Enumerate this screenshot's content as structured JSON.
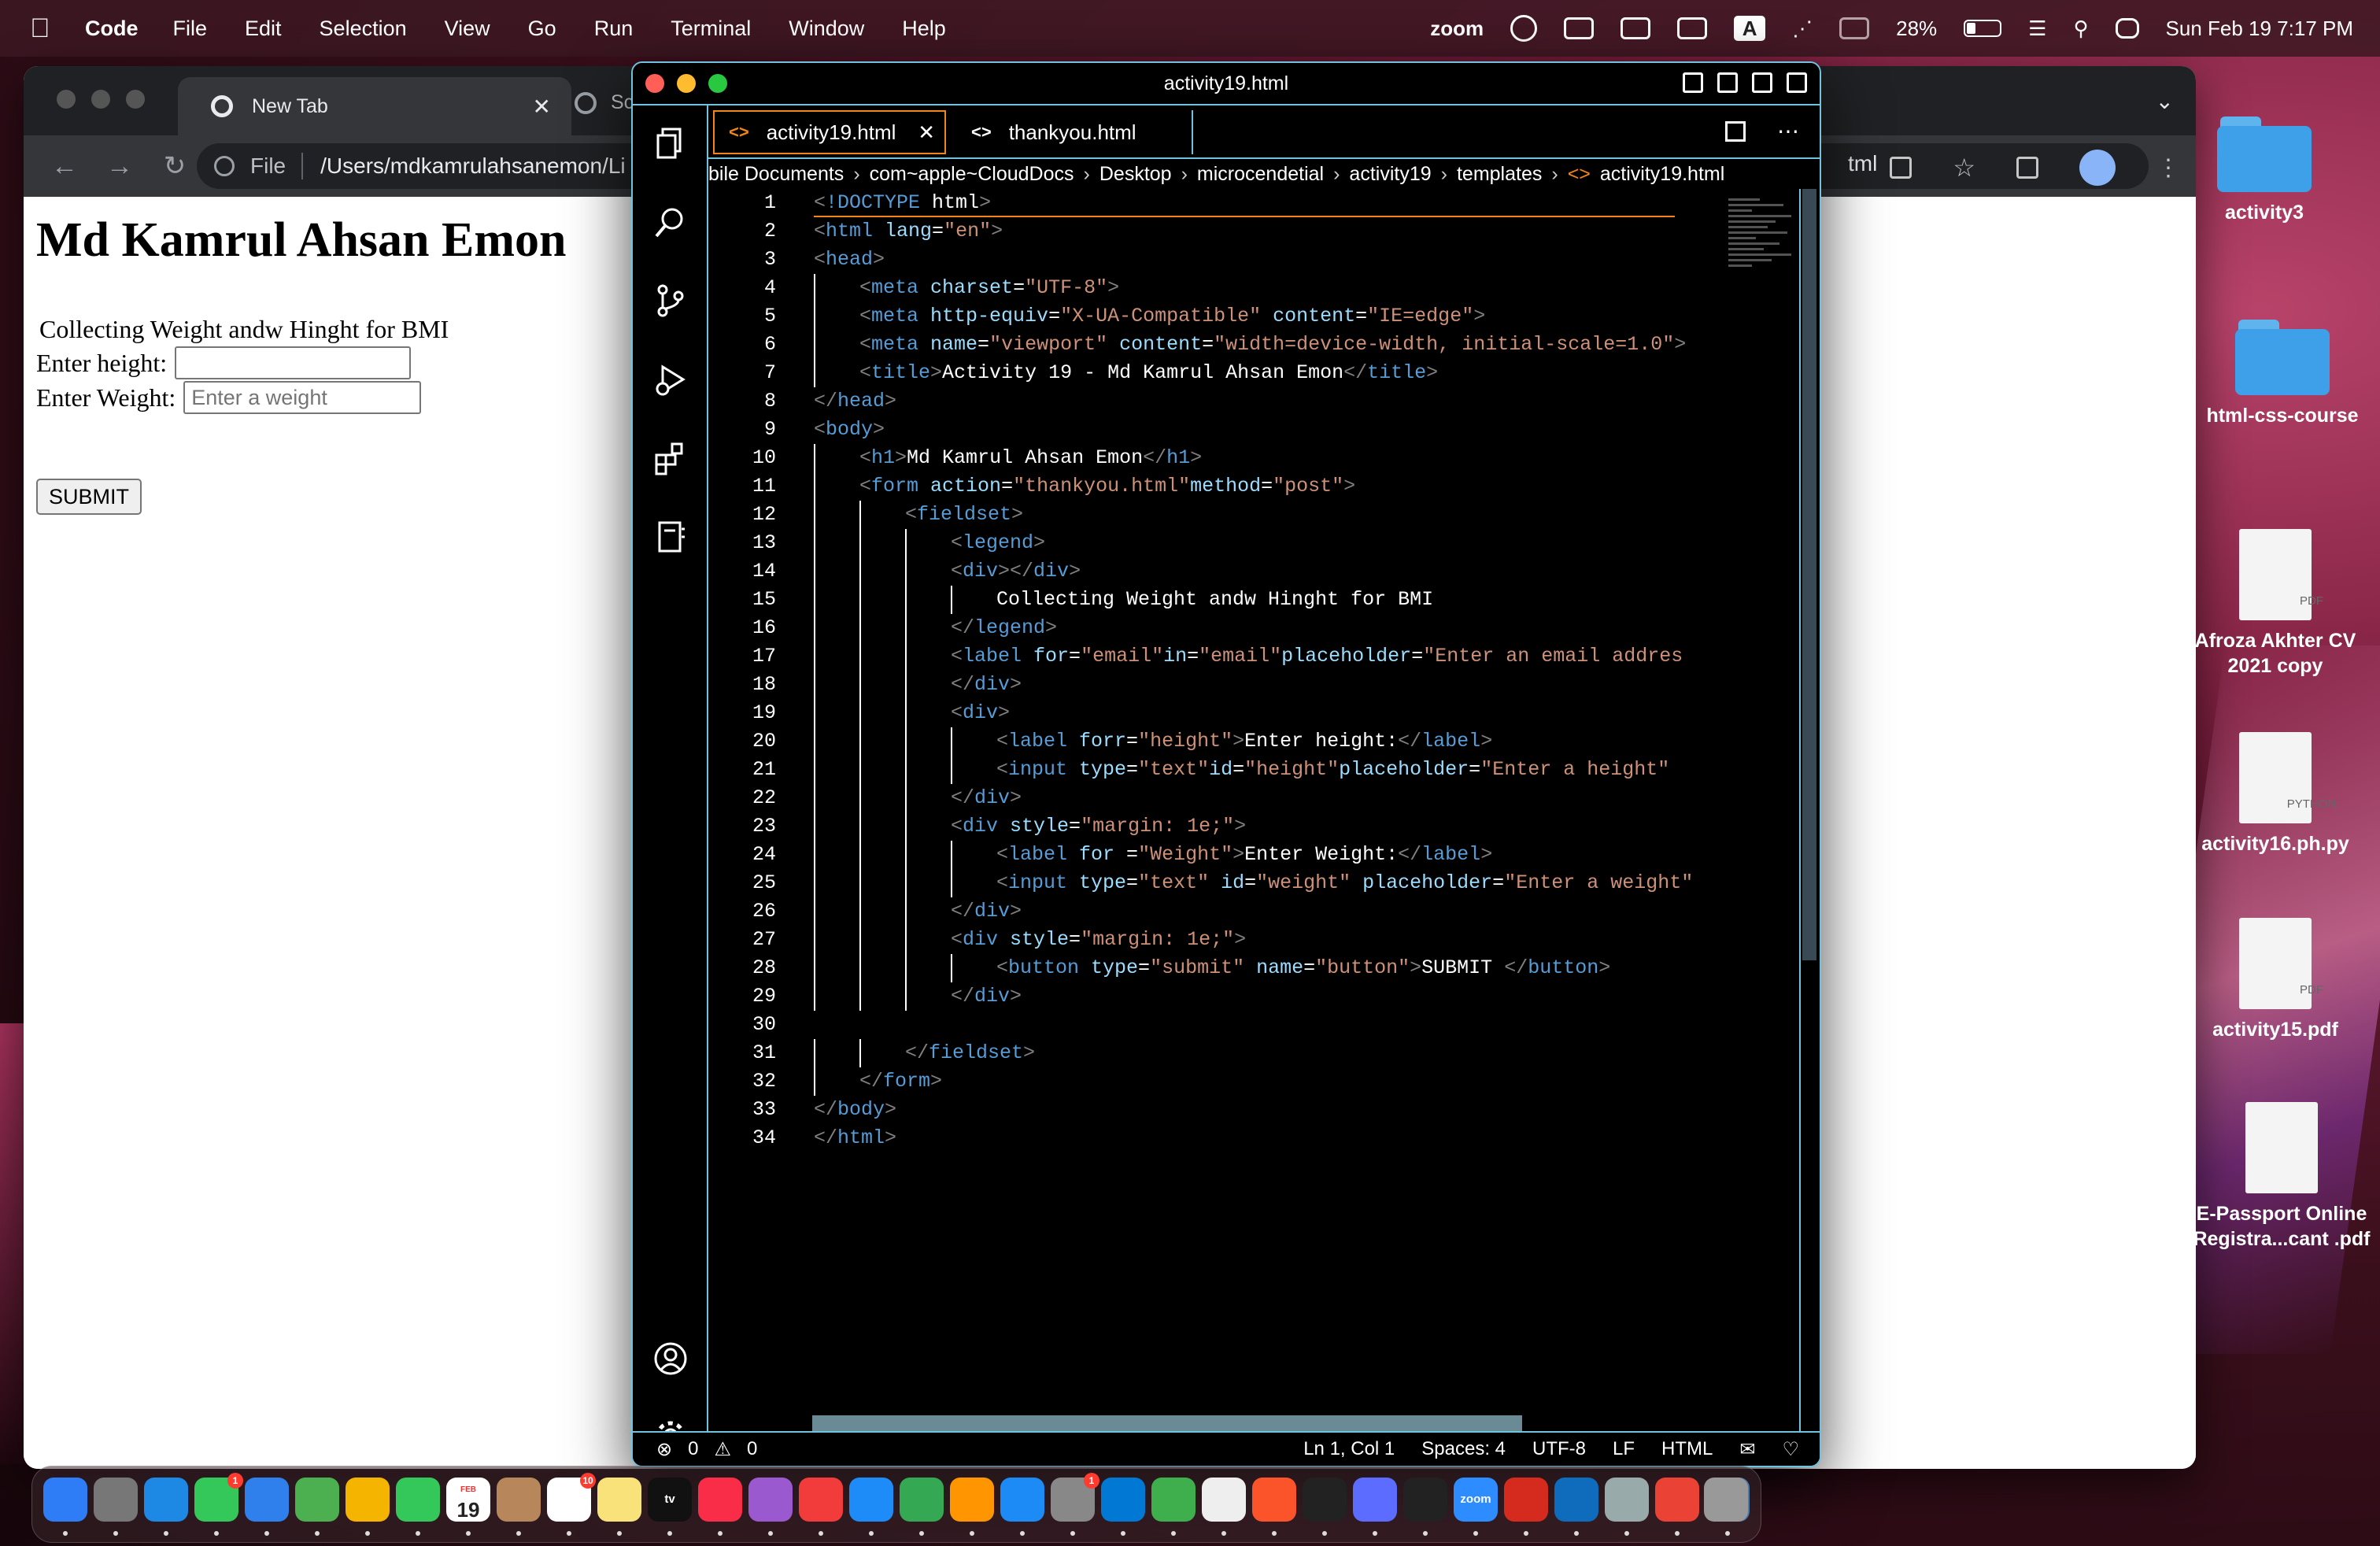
{
  "menubar": {
    "app_name": "Code",
    "items": [
      "File",
      "Edit",
      "Selection",
      "View",
      "Go",
      "Run",
      "Terminal",
      "Window",
      "Help"
    ],
    "status": {
      "zoom": "zoom",
      "battery": "28%",
      "battery_level": 0.28,
      "clock": "Sun Feb 19  7:17 PM"
    }
  },
  "chrome": {
    "tab_label": "New Tab",
    "tab2_label": "Scr",
    "omnibox_scheme": "File",
    "omnibox_url": "/Users/mdkamrulahsanemon/Li",
    "omnibox_tail": "tml",
    "page": {
      "h1": "Md Kamrul Ahsan Emon",
      "legend": "Collecting Weight andw Hinght for BMI",
      "height_label": "Enter height:",
      "height_value": "",
      "weight_label": "Enter Weight:",
      "weight_placeholder": "Enter a weight",
      "submit_label": "SUBMIT"
    }
  },
  "vscode": {
    "title": "activity19.html",
    "tabs": [
      {
        "label": "activity19.html",
        "active": true
      },
      {
        "label": "thankyou.html",
        "active": false
      }
    ],
    "breadcrumb": [
      "bile Documents",
      "com~apple~CloudDocs",
      "Desktop",
      "microcendetial",
      "activity19",
      "templates",
      "activity19.html"
    ],
    "status": {
      "errors": "0",
      "warnings": "0",
      "position": "Ln 1, Col 1",
      "spaces": "Spaces: 4",
      "encoding": "UTF-8",
      "eol": "LF",
      "language": "HTML"
    }
  },
  "code_lines": [
    {
      "n": "1",
      "indent": 0,
      "tokens": [
        [
          "p",
          "<"
        ],
        [
          "t",
          "!DOCTYPE"
        ],
        [
          "w",
          " html"
        ],
        [
          "p",
          ">"
        ]
      ]
    },
    {
      "n": "2",
      "indent": 0,
      "tokens": [
        [
          "p",
          "<"
        ],
        [
          "t",
          "html"
        ],
        [
          "a",
          " lang"
        ],
        [
          "w",
          "="
        ],
        [
          "s",
          "\"en\""
        ],
        [
          "p",
          ">"
        ]
      ]
    },
    {
      "n": "3",
      "indent": 0,
      "tokens": [
        [
          "p",
          "<"
        ],
        [
          "t",
          "head"
        ],
        [
          "p",
          ">"
        ]
      ]
    },
    {
      "n": "4",
      "indent": 1,
      "tokens": [
        [
          "p",
          "<"
        ],
        [
          "t",
          "meta"
        ],
        [
          "a",
          " charset"
        ],
        [
          "w",
          "="
        ],
        [
          "s",
          "\"UTF-8\""
        ],
        [
          "p",
          ">"
        ]
      ]
    },
    {
      "n": "5",
      "indent": 1,
      "tokens": [
        [
          "p",
          "<"
        ],
        [
          "t",
          "meta"
        ],
        [
          "a",
          " http-equiv"
        ],
        [
          "w",
          "="
        ],
        [
          "s",
          "\"X-UA-Compatible\""
        ],
        [
          "a",
          " content"
        ],
        [
          "w",
          "="
        ],
        [
          "s",
          "\"IE=edge\""
        ],
        [
          "p",
          ">"
        ]
      ]
    },
    {
      "n": "6",
      "indent": 1,
      "tokens": [
        [
          "p",
          "<"
        ],
        [
          "t",
          "meta"
        ],
        [
          "a",
          " name"
        ],
        [
          "w",
          "="
        ],
        [
          "s",
          "\"viewport\""
        ],
        [
          "a",
          " content"
        ],
        [
          "w",
          "="
        ],
        [
          "s",
          "\"width=device-width, initial-scale=1.0\""
        ],
        [
          "p",
          ">"
        ]
      ]
    },
    {
      "n": "7",
      "indent": 1,
      "tokens": [
        [
          "p",
          "<"
        ],
        [
          "t",
          "title"
        ],
        [
          "p",
          ">"
        ],
        [
          "w",
          "Activity 19 - Md Kamrul Ahsan Emon"
        ],
        [
          "p",
          "</"
        ],
        [
          "t",
          "title"
        ],
        [
          "p",
          ">"
        ]
      ]
    },
    {
      "n": "8",
      "indent": 0,
      "tokens": [
        [
          "p",
          "</"
        ],
        [
          "t",
          "head"
        ],
        [
          "p",
          ">"
        ]
      ]
    },
    {
      "n": "9",
      "indent": 0,
      "tokens": [
        [
          "p",
          "<"
        ],
        [
          "t",
          "body"
        ],
        [
          "p",
          ">"
        ]
      ]
    },
    {
      "n": "10",
      "indent": 1,
      "tokens": [
        [
          "p",
          "<"
        ],
        [
          "t",
          "h1"
        ],
        [
          "p",
          ">"
        ],
        [
          "w",
          "Md Kamrul Ahsan Emon"
        ],
        [
          "p",
          "</"
        ],
        [
          "t",
          "h1"
        ],
        [
          "p",
          ">"
        ]
      ]
    },
    {
      "n": "11",
      "indent": 1,
      "tokens": [
        [
          "p",
          "<"
        ],
        [
          "t",
          "form"
        ],
        [
          "a",
          " action"
        ],
        [
          "w",
          "="
        ],
        [
          "s",
          "\"thankyou.html\""
        ],
        [
          "a",
          "method"
        ],
        [
          "w",
          "="
        ],
        [
          "s",
          "\"post\""
        ],
        [
          "p",
          ">"
        ]
      ]
    },
    {
      "n": "12",
      "indent": 2,
      "tokens": [
        [
          "p",
          "<"
        ],
        [
          "t",
          "fieldset"
        ],
        [
          "p",
          ">"
        ]
      ]
    },
    {
      "n": "13",
      "indent": 3,
      "tokens": [
        [
          "p",
          "<"
        ],
        [
          "t",
          "legend"
        ],
        [
          "p",
          ">"
        ]
      ]
    },
    {
      "n": "14",
      "indent": 3,
      "tokens": [
        [
          "p",
          "<"
        ],
        [
          "t",
          "div"
        ],
        [
          "p",
          "></"
        ],
        [
          "t",
          "div"
        ],
        [
          "p",
          ">"
        ]
      ]
    },
    {
      "n": "15",
      "indent": 4,
      "tokens": [
        [
          "w",
          "Collecting Weight andw Hinght for BMI"
        ]
      ]
    },
    {
      "n": "16",
      "indent": 3,
      "tokens": [
        [
          "p",
          "</"
        ],
        [
          "t",
          "legend"
        ],
        [
          "p",
          ">"
        ]
      ]
    },
    {
      "n": "17",
      "indent": 3,
      "tokens": [
        [
          "p",
          "<"
        ],
        [
          "t",
          "label"
        ],
        [
          "a",
          " for"
        ],
        [
          "w",
          "="
        ],
        [
          "s",
          "\"email\""
        ],
        [
          "a",
          "in"
        ],
        [
          "w",
          "="
        ],
        [
          "s",
          "\"email\""
        ],
        [
          "a",
          "placeholder"
        ],
        [
          "w",
          "="
        ],
        [
          "s",
          "\"Enter an email addres"
        ]
      ]
    },
    {
      "n": "18",
      "indent": 3,
      "tokens": [
        [
          "p",
          "</"
        ],
        [
          "t",
          "div"
        ],
        [
          "p",
          ">"
        ]
      ]
    },
    {
      "n": "19",
      "indent": 3,
      "tokens": [
        [
          "p",
          "<"
        ],
        [
          "t",
          "div"
        ],
        [
          "p",
          ">"
        ]
      ]
    },
    {
      "n": "20",
      "indent": 4,
      "tokens": [
        [
          "p",
          "<"
        ],
        [
          "t",
          "label"
        ],
        [
          "a",
          " forr"
        ],
        [
          "w",
          "="
        ],
        [
          "s",
          "\"height\""
        ],
        [
          "p",
          ">"
        ],
        [
          "w",
          "Enter height:"
        ],
        [
          "p",
          "</"
        ],
        [
          "t",
          "label"
        ],
        [
          "p",
          ">"
        ]
      ]
    },
    {
      "n": "21",
      "indent": 4,
      "tokens": [
        [
          "p",
          "<"
        ],
        [
          "t",
          "input"
        ],
        [
          "a",
          " type"
        ],
        [
          "w",
          "="
        ],
        [
          "s",
          "\"text\""
        ],
        [
          "a",
          "id"
        ],
        [
          "w",
          "="
        ],
        [
          "s",
          "\"height\""
        ],
        [
          "a",
          "placeholder"
        ],
        [
          "w",
          "="
        ],
        [
          "s",
          "\"Enter a height\""
        ]
      ]
    },
    {
      "n": "22",
      "indent": 3,
      "tokens": [
        [
          "p",
          "</"
        ],
        [
          "t",
          "div"
        ],
        [
          "p",
          ">"
        ]
      ]
    },
    {
      "n": "23",
      "indent": 3,
      "tokens": [
        [
          "p",
          "<"
        ],
        [
          "t",
          "div"
        ],
        [
          "a",
          " style"
        ],
        [
          "w",
          "="
        ],
        [
          "s",
          "\"margin: 1e;\""
        ],
        [
          "p",
          ">"
        ]
      ]
    },
    {
      "n": "24",
      "indent": 4,
      "tokens": [
        [
          "p",
          "<"
        ],
        [
          "t",
          "label"
        ],
        [
          "a",
          " for "
        ],
        [
          "w",
          "="
        ],
        [
          "s",
          "\"Weight\""
        ],
        [
          "p",
          ">"
        ],
        [
          "w",
          "Enter Weight:"
        ],
        [
          "p",
          "</"
        ],
        [
          "t",
          "label"
        ],
        [
          "p",
          ">"
        ]
      ]
    },
    {
      "n": "25",
      "indent": 4,
      "tokens": [
        [
          "p",
          "<"
        ],
        [
          "t",
          "input"
        ],
        [
          "a",
          " type"
        ],
        [
          "w",
          "="
        ],
        [
          "s",
          "\"text\""
        ],
        [
          "a",
          " id"
        ],
        [
          "w",
          "="
        ],
        [
          "s",
          "\"weight\""
        ],
        [
          "a",
          " placeholder"
        ],
        [
          "w",
          "="
        ],
        [
          "s",
          "\"Enter a weight\""
        ]
      ]
    },
    {
      "n": "26",
      "indent": 3,
      "tokens": [
        [
          "p",
          "</"
        ],
        [
          "t",
          "div"
        ],
        [
          "p",
          ">"
        ]
      ]
    },
    {
      "n": "27",
      "indent": 3,
      "tokens": [
        [
          "p",
          "<"
        ],
        [
          "t",
          "div"
        ],
        [
          "a",
          " style"
        ],
        [
          "w",
          "="
        ],
        [
          "s",
          "\"margin: 1e;\""
        ],
        [
          "p",
          ">"
        ]
      ]
    },
    {
      "n": "28",
      "indent": 4,
      "tokens": [
        [
          "p",
          "<"
        ],
        [
          "t",
          "button"
        ],
        [
          "a",
          " type"
        ],
        [
          "w",
          "="
        ],
        [
          "s",
          "\"submit\""
        ],
        [
          "a",
          " name"
        ],
        [
          "w",
          "="
        ],
        [
          "s",
          "\"button\""
        ],
        [
          "p",
          ">"
        ],
        [
          "w",
          "SUBMIT "
        ],
        [
          "p",
          "</"
        ],
        [
          "t",
          "button"
        ],
        [
          "p",
          ">"
        ]
      ]
    },
    {
      "n": "29",
      "indent": 3,
      "tokens": [
        [
          "p",
          "</"
        ],
        [
          "t",
          "div"
        ],
        [
          "p",
          ">"
        ]
      ]
    },
    {
      "n": "30",
      "indent": 0,
      "tokens": []
    },
    {
      "n": "31",
      "indent": 2,
      "tokens": [
        [
          "p",
          "</"
        ],
        [
          "t",
          "fieldset"
        ],
        [
          "p",
          ">"
        ]
      ]
    },
    {
      "n": "32",
      "indent": 1,
      "tokens": [
        [
          "p",
          "</"
        ],
        [
          "t",
          "form"
        ],
        [
          "p",
          ">"
        ]
      ]
    },
    {
      "n": "33",
      "indent": 0,
      "tokens": [
        [
          "p",
          "</"
        ],
        [
          "t",
          "body"
        ],
        [
          "p",
          ">"
        ]
      ]
    },
    {
      "n": "34",
      "indent": 0,
      "tokens": [
        [
          "p",
          "</"
        ],
        [
          "t",
          "html"
        ],
        [
          "p",
          ">"
        ]
      ]
    }
  ],
  "desktop_icons": [
    {
      "label": "activity3",
      "kind": "folder"
    },
    {
      "label": "html-css-course",
      "kind": "folder"
    },
    {
      "label": "Afroza Akhter CV 2021 copy",
      "kind": "doc",
      "badge": "PDF"
    },
    {
      "label": "activity16.ph.py",
      "kind": "doc",
      "badge": "PYTHON"
    },
    {
      "label": "activity15.pdf",
      "kind": "doc",
      "badge": "PDF"
    },
    {
      "label": "E-Passport Online Registra...cant .pdf",
      "kind": "doc",
      "badge": ""
    }
  ],
  "dock": {
    "apps": [
      "finder-icon",
      "launchpad-icon",
      "safari-icon",
      "messages-icon",
      "mail-icon",
      "maps-icon",
      "photos-icon",
      "facetime-icon",
      "calendar-icon",
      "contacts-icon",
      "reminders-icon",
      "notes-icon",
      "tv-icon",
      "music-icon",
      "podcasts-icon",
      "news-icon",
      "keynote-icon",
      "numbers-icon",
      "pages-icon",
      "app-store-icon",
      "system-preferences-icon",
      "vscode-icon",
      "cloud-app-icon",
      "textedit-icon",
      "brave-icon",
      "terminal-icon",
      "proton-icon",
      "activity-monitor-icon",
      "zoom-icon",
      "acrobat-icon",
      "outlook-icon",
      "preview-icon",
      "chrome-icon",
      "pgadmin-icon"
    ],
    "calendar_month": "FEB",
    "calendar_day": "19",
    "tv_label": "tv",
    "zoom_label": "zoom",
    "badges": {
      "messages": "1",
      "reminders": "10",
      "system_preferences": "1"
    }
  }
}
